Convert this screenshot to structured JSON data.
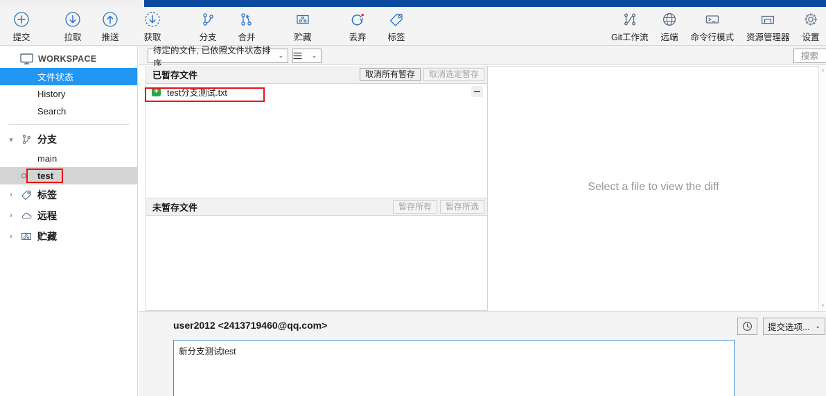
{
  "window": {
    "accent_color": "#0b4a9e"
  },
  "toolbar": {
    "left_buttons": [
      {
        "label": "提交",
        "icon": "plus-circle-icon"
      },
      {
        "label": "拉取",
        "icon": "arrow-down-circle-icon"
      },
      {
        "label": "推送",
        "icon": "arrow-up-circle-icon"
      }
    ],
    "mid_buttons": [
      {
        "label": "获取",
        "icon": "arrow-down-dashed-circle-icon"
      },
      {
        "label": "分支",
        "icon": "branch-icon"
      },
      {
        "label": "合并",
        "icon": "merge-icon"
      },
      {
        "label": "贮藏",
        "icon": "stash-icon"
      },
      {
        "label": "丢弃",
        "icon": "discard-refresh-icon"
      },
      {
        "label": "标签",
        "icon": "tag-icon"
      }
    ],
    "right_buttons": [
      {
        "label": "Git工作流",
        "icon": "git-flow-icon"
      },
      {
        "label": "远端",
        "icon": "globe-icon"
      },
      {
        "label": "命令行模式",
        "icon": "terminal-icon"
      },
      {
        "label": "资源管理器",
        "icon": "explorer-folder-icon"
      },
      {
        "label": "设置",
        "icon": "gear-icon"
      }
    ]
  },
  "sidebar": {
    "workspace_label": "WORKSPACE",
    "workspace_icon": "monitor-icon",
    "items": [
      {
        "label": "文件状态",
        "selected": true
      },
      {
        "label": "History",
        "selected": false
      },
      {
        "label": "Search",
        "selected": false
      }
    ],
    "groups": [
      {
        "label": "分支",
        "icon": "branch-icon",
        "expanded": true,
        "chevron": "▾",
        "branches": [
          {
            "label": "main",
            "current": false
          },
          {
            "label": "test",
            "current": true
          }
        ]
      },
      {
        "label": "标签",
        "icon": "tag-icon",
        "expanded": false,
        "chevron": "›"
      },
      {
        "label": "远程",
        "icon": "cloud-icon",
        "expanded": false,
        "chevron": "›"
      },
      {
        "label": "贮藏",
        "icon": "stash-icon",
        "expanded": false,
        "chevron": "›"
      }
    ]
  },
  "filterbar": {
    "sort_combo": "待定的文件, 已依照文件状态排序",
    "sort_caret": "⌄",
    "view_combo_icon": "list-view-icon",
    "view_caret": "⌄",
    "search": {
      "placeholder": "搜索",
      "value": "",
      "icon": "search-icon"
    }
  },
  "staged": {
    "title": "已暂存文件",
    "unstage_all_label": "取消所有暂存",
    "unstage_selected_label": "取消选定暂存",
    "unstage_selected_disabled": true,
    "files": [
      {
        "name": "test分支测试.txt",
        "status": "added",
        "status_glyph": "+",
        "status_color": "#28a745"
      }
    ]
  },
  "unstaged": {
    "title": "未暂存文件",
    "stage_all_label": "暂存所有",
    "stage_selected_label": "暂存所选",
    "stage_all_disabled": true,
    "stage_selected_disabled": true,
    "files": []
  },
  "diff": {
    "empty_message": "Select a file to view the diff"
  },
  "commit": {
    "author": "user2012 <2413719460@qq.com>",
    "history_icon": "clock-icon",
    "options_label": "提交选项...",
    "options_caret": "⌄",
    "message_value": "新分支测试test",
    "message_placeholder": ""
  }
}
